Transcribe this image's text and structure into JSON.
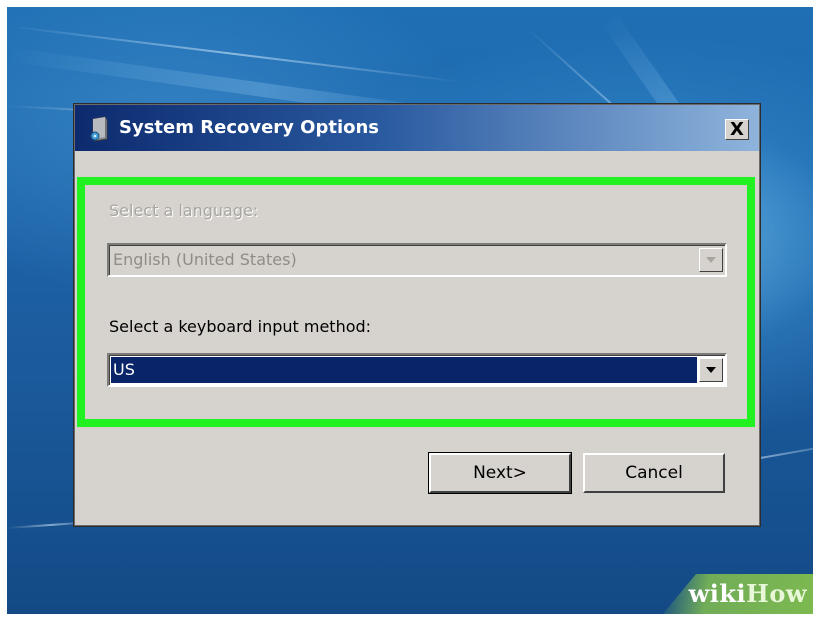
{
  "window": {
    "title": "System Recovery Options",
    "close_label": "X"
  },
  "language": {
    "label": "Select a language:",
    "value": "English (United States)",
    "enabled": false
  },
  "keyboard": {
    "label": "Select a keyboard input method:",
    "value": "US",
    "enabled": true
  },
  "buttons": {
    "next": "Next>",
    "cancel": "Cancel"
  },
  "watermark": {
    "part1": "wiki",
    "part2": "How"
  },
  "colors": {
    "highlight": "#21f021",
    "titlebar_start": "#0d2a6e",
    "selection": "#0a246a",
    "dialog_face": "#d6d3ce"
  }
}
